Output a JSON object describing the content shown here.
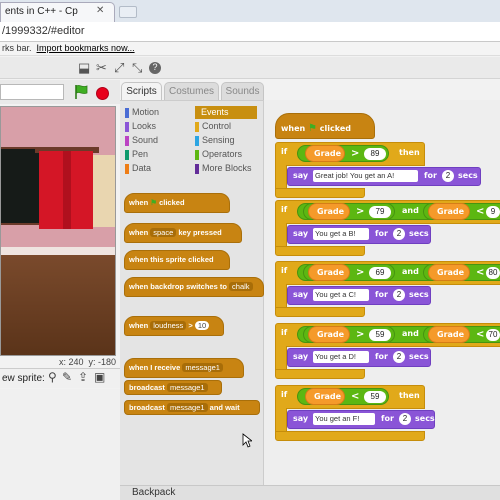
{
  "browser": {
    "tab_title": "ents in C++ - Cp",
    "address": "/1999332/#editor",
    "bookmarks_text": "rks bar.",
    "import_link": "Import bookmarks now..."
  },
  "stage": {
    "x_label": "x: 240",
    "y_label": "y: -180",
    "new_sprite_label": "ew sprite:"
  },
  "tabs": {
    "scripts": "Scripts",
    "costumes": "Costumes",
    "sounds": "Sounds"
  },
  "categories": [
    {
      "label": "Motion",
      "color": "#4a6cd4"
    },
    {
      "label": "Looks",
      "color": "#8a55d7"
    },
    {
      "label": "Sound",
      "color": "#bb42c3"
    },
    {
      "label": "Pen",
      "color": "#0e9a6c"
    },
    {
      "label": "Data",
      "color": "#ee7d16"
    },
    {
      "label": "Events",
      "color": "#c88330"
    },
    {
      "label": "Control",
      "color": "#e1a91a"
    },
    {
      "label": "Sensing",
      "color": "#2ca5e2"
    },
    {
      "label": "Operators",
      "color": "#5cb712"
    },
    {
      "label": "More Blocks",
      "color": "#632d99"
    }
  ],
  "palette": {
    "when": "when",
    "clicked": "clicked",
    "space": "space",
    "key_pressed": "key pressed",
    "when_sprite_clicked": "when this sprite clicked",
    "when_backdrop": "when backdrop switches to",
    "backdrop_value": "chalk",
    "loudness": "loudness",
    "gt": ">",
    "loudness_value": "10",
    "when_receive": "when I receive",
    "message1": "message1",
    "broadcast": "broadcast",
    "broadcast_wait": "and wait"
  },
  "script": {
    "hat_when": "when",
    "hat_clicked": "clicked",
    "if": "if",
    "then": "then",
    "and": "and",
    "say": "say",
    "for": "for",
    "secs": "secs",
    "grade": "Grade",
    "rows": [
      {
        "op1": ">",
        "v1": "89",
        "msg": "Great job!  You get an A!",
        "secs": "2"
      },
      {
        "op1": ">",
        "v1": "79",
        "op2": "<",
        "v2": "9",
        "msg": "You get a B!",
        "secs": "2"
      },
      {
        "op1": ">",
        "v1": "69",
        "op2": "<",
        "v2": "80",
        "msg": "You get a C!",
        "secs": "2"
      },
      {
        "op1": ">",
        "v1": "59",
        "op2": "<",
        "v2": "70",
        "msg": "You get a D!",
        "secs": "2"
      },
      {
        "op1": "<",
        "v1": "59",
        "msg": "You get an F!",
        "secs": "2"
      }
    ]
  },
  "backpack": "Backpack",
  "colors": {
    "events": "#c88412",
    "control": "#e1a91a",
    "looks": "#8a55d7",
    "operators": "#5cb712",
    "sensing": "#f59a2a"
  }
}
